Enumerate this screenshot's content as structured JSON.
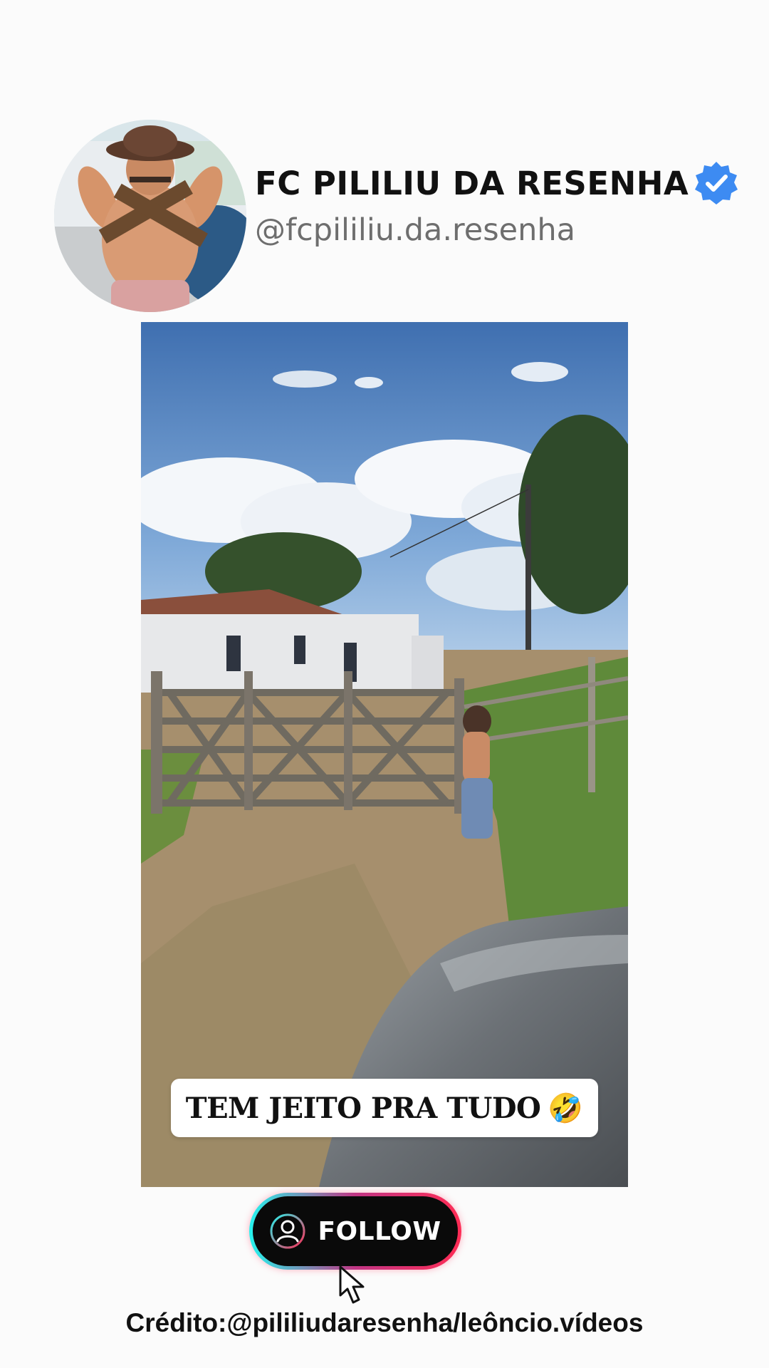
{
  "profile": {
    "name": "FC PILILIU DA RESENHA",
    "handle": "@fcpililiu.da.resenha",
    "verified_icon": "verified-badge-icon",
    "verified_color": "#3d8bf2"
  },
  "video": {
    "caption": "TEM JEITO PRA TUDO",
    "caption_emoji": "🤣"
  },
  "follow_button": {
    "label": "FOLLOW",
    "icon": "user-icon",
    "colors": {
      "cyan": "#25f4ee",
      "pink": "#fe2c55"
    }
  },
  "credit": "Crédito:@pililiudaresenha/leôncio.vídeos"
}
